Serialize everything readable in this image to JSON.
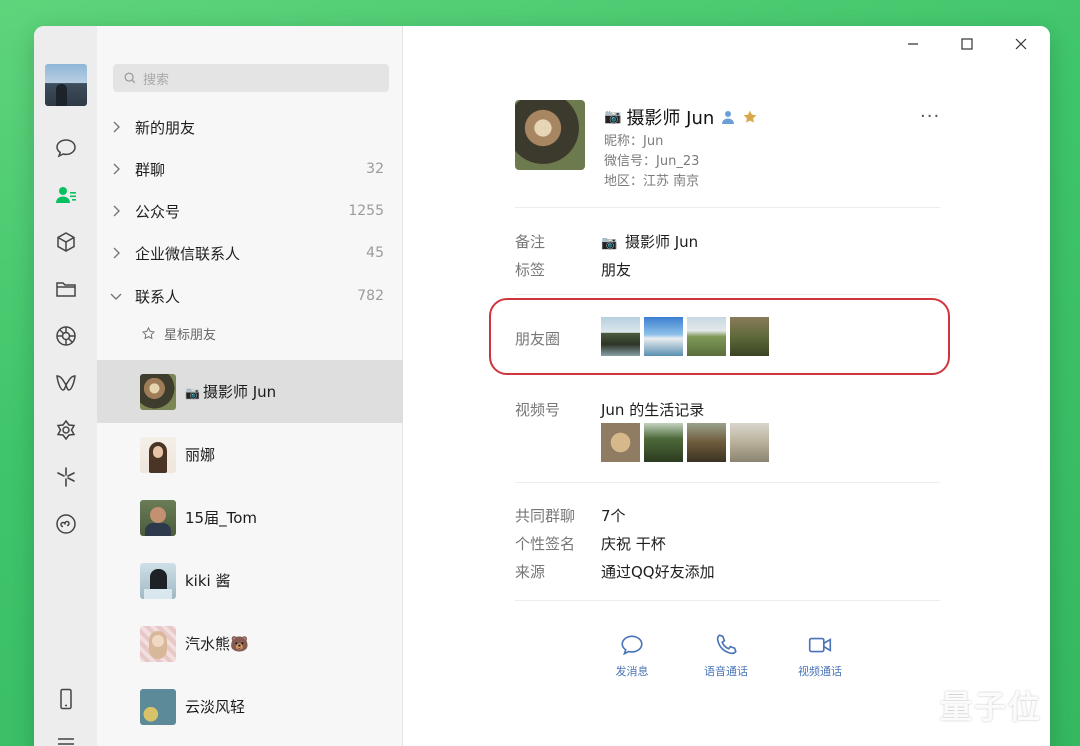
{
  "colors": {
    "accent": "#07c160",
    "link": "#4a74b8",
    "highlight": "#d0353d"
  },
  "rail": {
    "items": [
      {
        "name": "chat-icon"
      },
      {
        "name": "contacts-icon"
      },
      {
        "name": "favorites-icon"
      },
      {
        "name": "folder-icon"
      },
      {
        "name": "moments-icon"
      },
      {
        "name": "channels-icon"
      },
      {
        "name": "search-mini-icon"
      },
      {
        "name": "look-icon"
      },
      {
        "name": "mini-program-icon"
      },
      {
        "name": "phone-icon"
      },
      {
        "name": "menu-icon"
      }
    ]
  },
  "search": {
    "placeholder": "搜索"
  },
  "groups": [
    {
      "label": "新的朋友",
      "count": ""
    },
    {
      "label": "群聊",
      "count": "32"
    },
    {
      "label": "公众号",
      "count": "1255"
    },
    {
      "label": "企业微信联系人",
      "count": "45"
    },
    {
      "label": "联系人",
      "count": "782"
    }
  ],
  "starred": {
    "label": "星标朋友"
  },
  "contacts": [
    {
      "name": "摄影师 Jun",
      "selected": true
    },
    {
      "name": "丽娜"
    },
    {
      "name": "15届_Tom"
    },
    {
      "name": "kiki 酱"
    },
    {
      "name": "汽水熊🐻"
    },
    {
      "name": "云淡风轻"
    }
  ],
  "profile": {
    "name": "摄影师 Jun",
    "nickname": "昵称：Jun",
    "wechat_id": "微信号：Jun_23",
    "region": "地区：江苏 南京",
    "remark_label": "备注",
    "remark_value": "摄影师 Jun",
    "tag_label": "标签",
    "tag_value": "朋友",
    "moments_label": "朋友圈",
    "channels_label": "视频号",
    "channels_value": "Jun 的生活记录",
    "groups_label": "共同群聊",
    "groups_value": "7个",
    "signature_label": "个性签名",
    "signature_value": "庆祝 干杯",
    "source_label": "来源",
    "source_value": "通过QQ好友添加"
  },
  "actions": {
    "message": "发消息",
    "voice": "语音通话",
    "video": "视频通话"
  },
  "watermark": "量子位"
}
